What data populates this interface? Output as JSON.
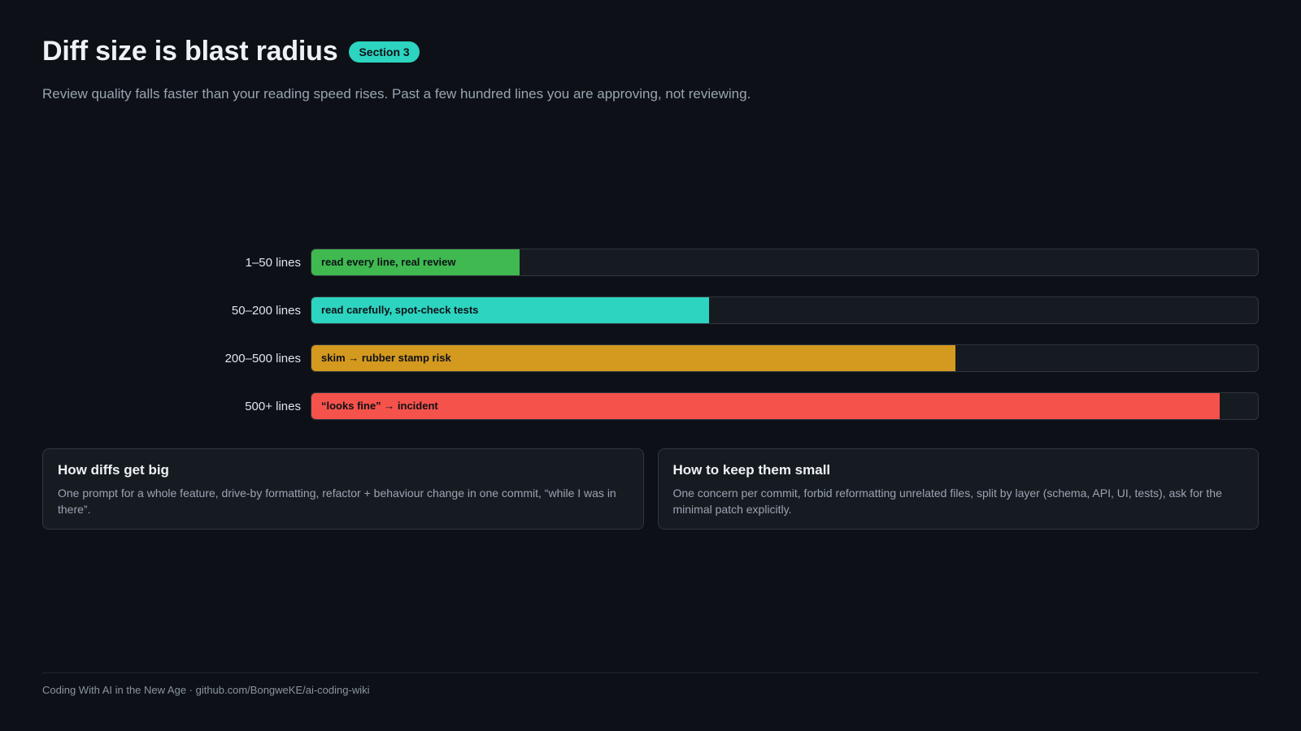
{
  "header": {
    "title": "Diff size is blast radius",
    "badge": "Section 3",
    "subtitle": "Review quality falls faster than your reading speed rises. Past a few hundred lines you are approving, not reviewing."
  },
  "colors": {
    "background": "#0d1117",
    "accent": "#2dd4bf",
    "green": "#3fb950",
    "teal": "#2dd4bf",
    "amber": "#d4991f",
    "red": "#f5524b"
  },
  "chart_data": {
    "type": "bar",
    "orientation": "horizontal",
    "categories": [
      "1–50 lines",
      "50–200 lines",
      "200–500 lines",
      "500+ lines"
    ],
    "bar_labels": [
      "read every line, real review",
      "read carefully, spot-check tests",
      "skim → rubber stamp risk",
      "“looks fine” → incident"
    ],
    "values": [
      22,
      42,
      68,
      96
    ],
    "xlim": [
      0,
      100
    ],
    "bar_colors": [
      "#3fb950",
      "#2dd4bf",
      "#d4991f",
      "#f5524b"
    ],
    "grid": false
  },
  "cards": [
    {
      "title": "How diffs get big",
      "body": "One prompt for a whole feature, drive-by formatting, refactor + behaviour change in one commit, “while I was in there”."
    },
    {
      "title": "How to keep them small",
      "body": "One concern per commit, forbid reformatting unrelated files, split by layer (schema, API, UI, tests), ask for the minimal patch explicitly."
    }
  ],
  "footer": {
    "text": "Coding With AI in the New Age · github.com/BongweKE/ai-coding-wiki"
  }
}
